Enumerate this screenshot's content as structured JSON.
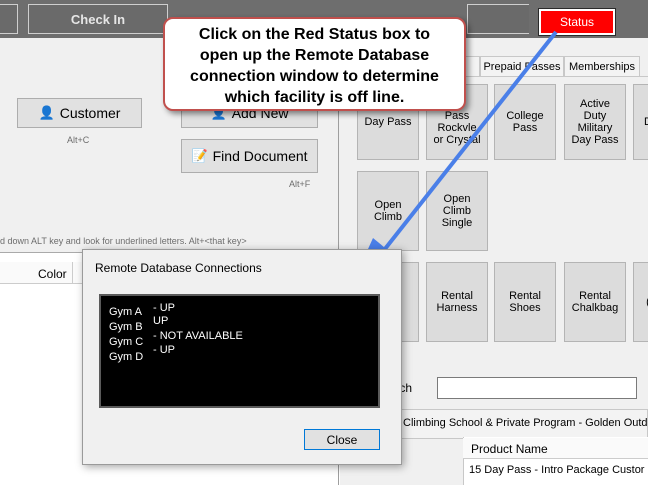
{
  "topbar": {
    "check_in_label": "Check In",
    "status_label": "Status"
  },
  "callout": {
    "lines": [
      "Click on the Red Status box to",
      "open up the Remote Database",
      "connection window to determine",
      "which facility is off line."
    ]
  },
  "left_panel": {
    "customer_label": "Customer",
    "customer_shortcut": "Alt+C",
    "add_new_label": "Add New",
    "find_document_label": "Find Document",
    "find_document_shortcut": "Alt+F",
    "alt_hint": "d down ALT key and look for underlined letters.  Alt+<that key>",
    "table_header_color": "Color"
  },
  "tabs": [
    "s",
    "Prepaid Passes",
    "Memberships"
  ],
  "tiles": [
    [
      "Day Pass"
    ],
    [
      "it",
      "Pass",
      "Rockvle",
      "or Crystal"
    ],
    [
      "College",
      "Pass"
    ],
    [
      "Active",
      "Duty",
      "Military",
      "Day Pass"
    ],
    [
      "D"
    ],
    [
      "Open",
      "Climb"
    ],
    [
      "Open",
      "Climb",
      "Single"
    ],
    [
      "e"
    ],
    [
      "Rental",
      "Harness"
    ],
    [
      "Rental",
      "Shoes"
    ],
    [
      "Rental",
      "Chalkbag"
    ],
    [
      "("
    ]
  ],
  "search_label": "earch",
  "program_label": "Climbing School & Private Program - Golden Outdo",
  "product_table": {
    "header": "Product Name",
    "rows": [
      "15 Day Pass - Intro Package Custor"
    ]
  },
  "dialog": {
    "title": "Remote Database Connections",
    "gyms": [
      {
        "name": "Gym A",
        "status": "- UP"
      },
      {
        "name": "Gym B",
        "status": "UP"
      },
      {
        "name": "Gym C",
        "status": "- NOT AVAILABLE"
      },
      {
        "name": "Gym D",
        "status": "- UP"
      }
    ],
    "close_label": "Close"
  },
  "colors": {
    "status_red": "#ff0000",
    "callout_border": "#c0504d",
    "arrow": "#4a7fe8",
    "close_focus": "#0078d7"
  }
}
